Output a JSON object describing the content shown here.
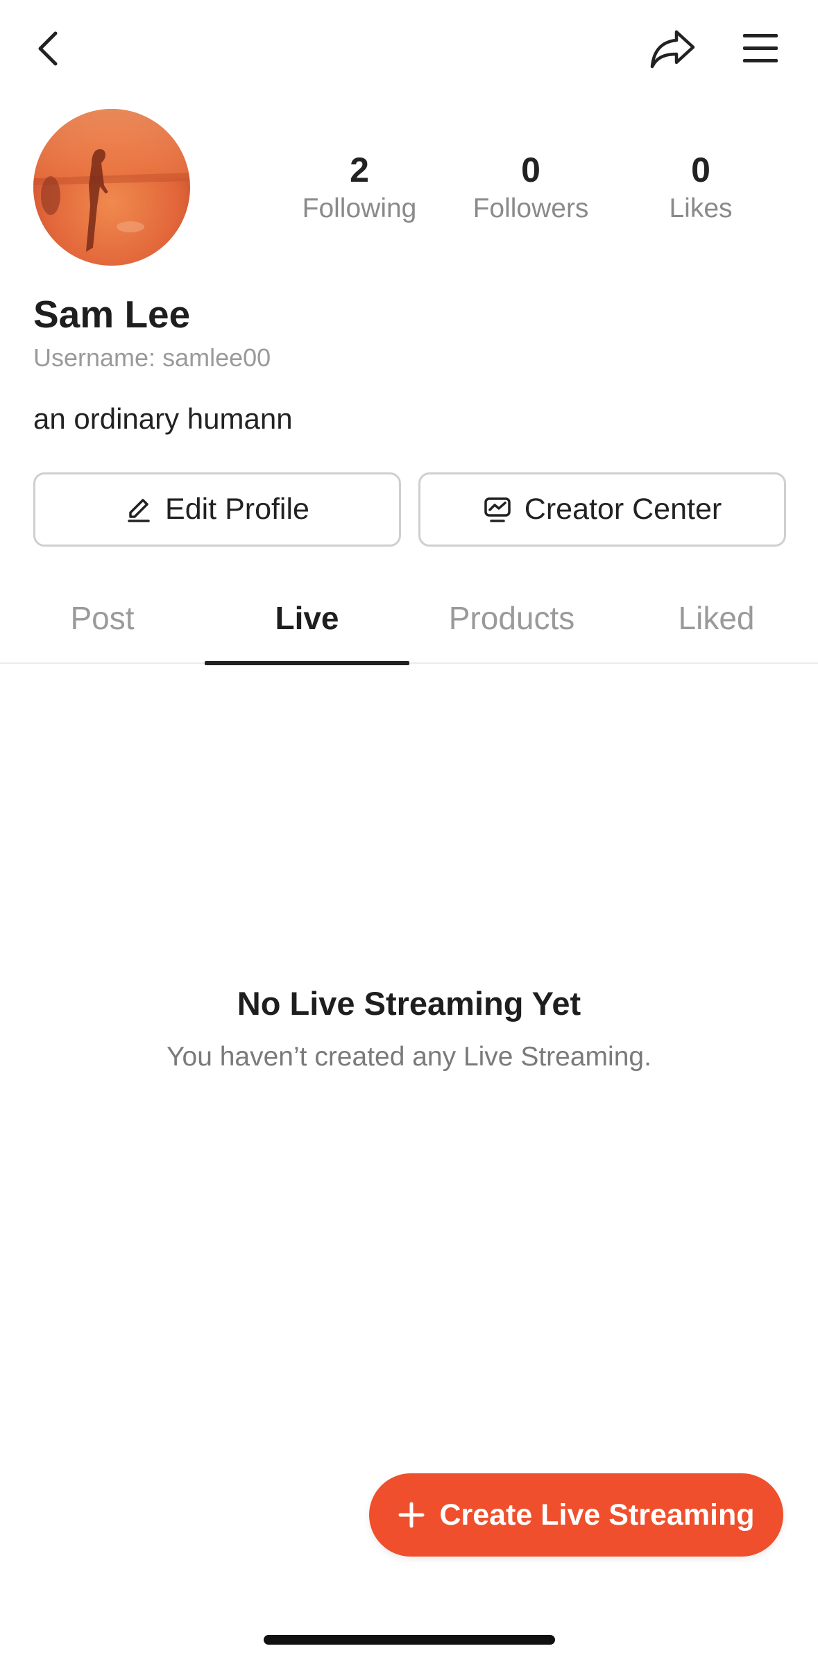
{
  "header": {
    "back_icon": "chevron-left-icon",
    "share_icon": "share-icon",
    "menu_icon": "hamburger-menu-icon"
  },
  "profile": {
    "name": "Sam Lee",
    "username": "Username: samlee00",
    "bio": "an ordinary humann",
    "stats": {
      "following": {
        "value": "2",
        "label": "Following"
      },
      "followers": {
        "value": "0",
        "label": "Followers"
      },
      "likes": {
        "value": "0",
        "label": "Likes"
      }
    }
  },
  "actions": {
    "edit_profile_label": "Edit Profile",
    "creator_center_label": "Creator Center"
  },
  "tabs": [
    {
      "label": "Post",
      "active": false
    },
    {
      "label": "Live",
      "active": true
    },
    {
      "label": "Products",
      "active": false
    },
    {
      "label": "Liked",
      "active": false
    }
  ],
  "empty_state": {
    "title": "No Live Streaming Yet",
    "subtitle": "You haven’t created any Live Streaming."
  },
  "fab": {
    "label": "Create Live Streaming"
  },
  "colors": {
    "accent": "#ef4f2c",
    "text_primary": "#1e1e1e",
    "text_secondary": "#8a8a8a"
  }
}
